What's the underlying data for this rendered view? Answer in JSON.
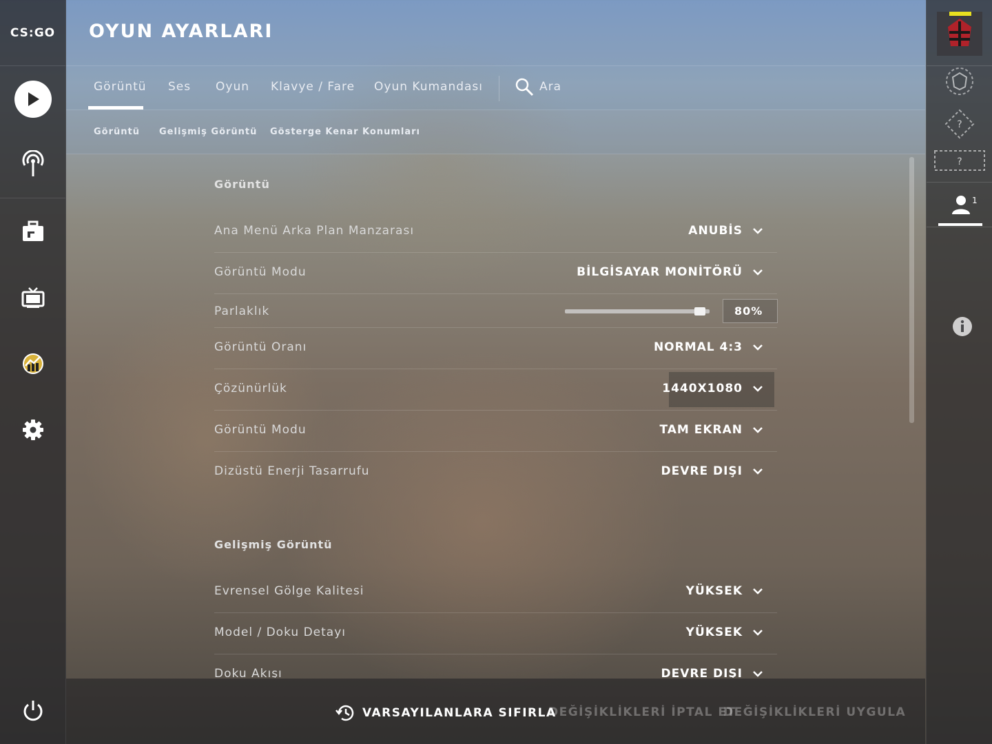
{
  "app": {
    "logo": "CS:GO",
    "title": "OYUN AYARLARI"
  },
  "tabs": [
    {
      "label": "Görüntü",
      "active": true
    },
    {
      "label": "Ses"
    },
    {
      "label": "Oyun"
    },
    {
      "label": "Klavye / Fare"
    },
    {
      "label": "Oyun Kumandası"
    }
  ],
  "search": {
    "label": "Ara",
    "icon": "search-icon"
  },
  "subtabs": [
    {
      "label": "Görüntü"
    },
    {
      "label": "Gelişmiş Görüntü"
    },
    {
      "label": "Gösterge Kenar Konumları"
    }
  ],
  "sections": {
    "display": {
      "title": "Görüntü",
      "rows": [
        {
          "label": "Ana Menü Arka Plan Manzarası",
          "value": "ANUBİS"
        },
        {
          "label": "Görüntü Modu",
          "value": "BİLGİSAYAR MONİTÖRÜ"
        },
        {
          "label": "Parlaklık",
          "value": "80%",
          "slider_fraction": 0.8
        },
        {
          "label": "Görüntü Oranı",
          "value": "NORMAL 4:3"
        },
        {
          "label": "Çözünürlük",
          "value": "1440X1080",
          "highlighted": true
        },
        {
          "label": "Görüntü Modu",
          "value": "TAM EKRAN"
        },
        {
          "label": "Dizüstü Enerji Tasarrufu",
          "value": "DEVRE DIŞI"
        }
      ]
    },
    "advanced": {
      "title": "Gelişmiş Görüntü",
      "rows": [
        {
          "label": "Evrensel Gölge Kalitesi",
          "value": "YÜKSEK"
        },
        {
          "label": "Model / Doku Detayı",
          "value": "YÜKSEK"
        },
        {
          "label": "Doku Akışı",
          "value": "DEVRE DIŞI"
        }
      ]
    }
  },
  "footer": {
    "reset": "VARSAYILANLARA SIFIRLA",
    "cancel": "DEĞİŞİKLİKLERİ İPTAL ET",
    "apply": "DEĞİŞİKLİKLERİ UYGULA"
  },
  "left_nav": [
    {
      "icon": "play-icon"
    },
    {
      "icon": "broadcast-icon"
    },
    {
      "icon": "inventory-briefcase-icon"
    },
    {
      "icon": "tv-icon"
    },
    {
      "icon": "stats-icon"
    },
    {
      "icon": "gear-icon"
    },
    {
      "icon": "power-icon"
    }
  ],
  "right_bar": {
    "friends_count": "1",
    "rank_icons": [
      "rank-emblem-icon",
      "unknown-rank-icon",
      "unknown-wingman-icon"
    ],
    "info_icon": "info-icon"
  },
  "colors": {
    "text": "#ffffff",
    "muted": "#8c8c8c",
    "accent_yellow": "#e8e020"
  }
}
